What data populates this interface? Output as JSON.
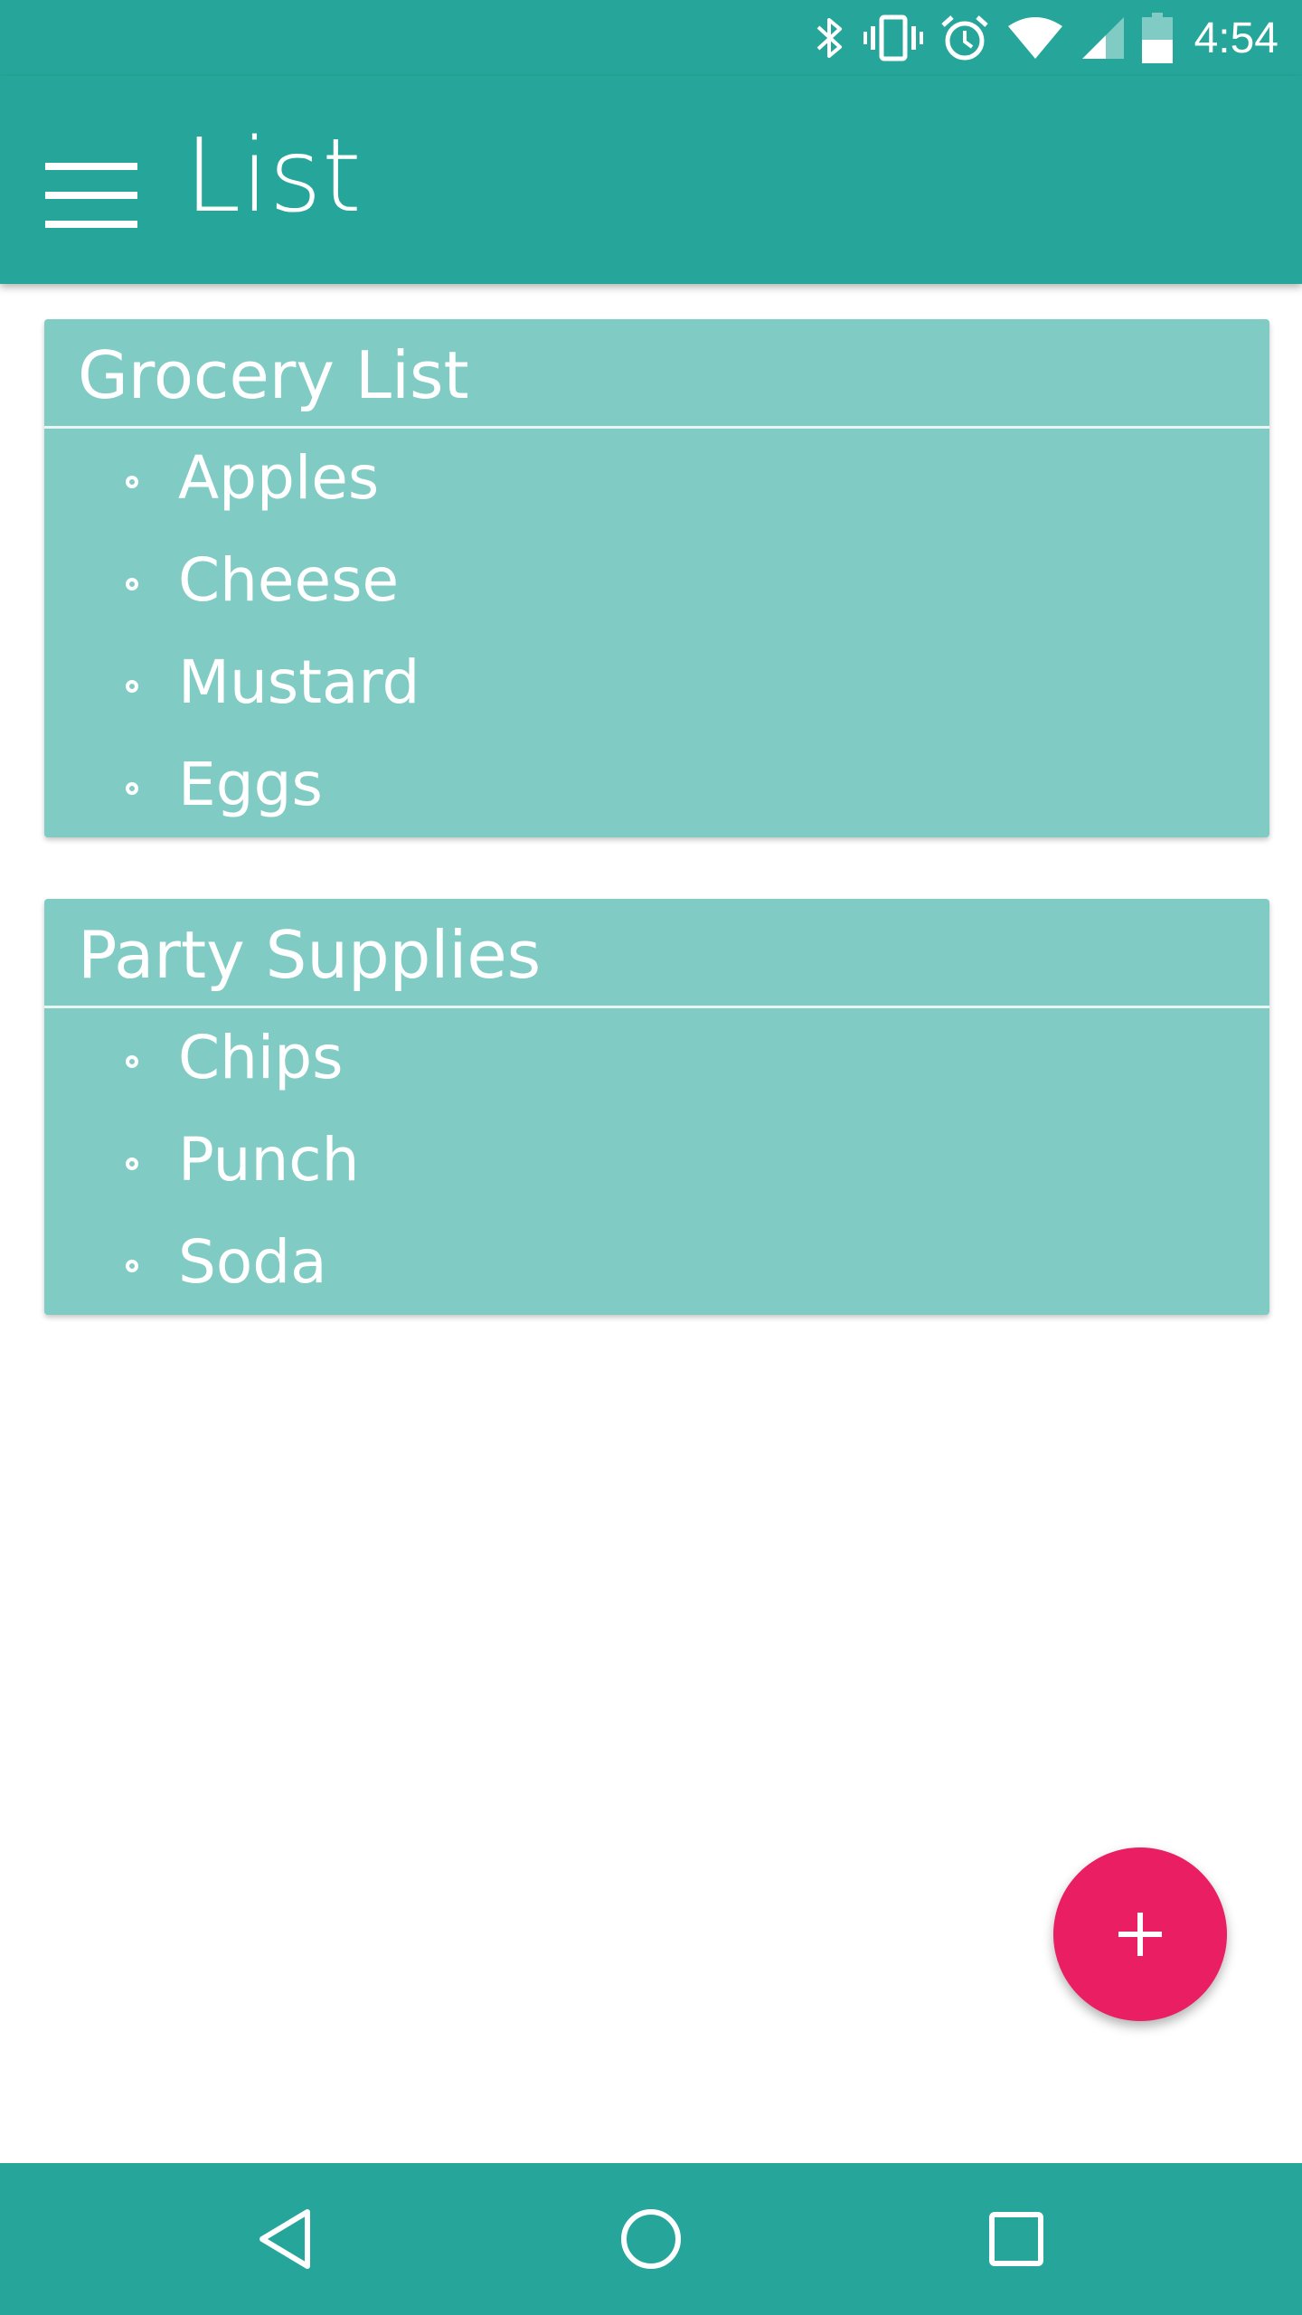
{
  "status_bar": {
    "time": "4:54",
    "icons": [
      "bluetooth-icon",
      "vibrate-icon",
      "alarm-icon",
      "wifi-icon",
      "cell-signal-icon",
      "battery-icon"
    ]
  },
  "app_bar": {
    "title": "List",
    "menu_icon": "hamburger-menu-icon"
  },
  "lists": [
    {
      "title": "Grocery List",
      "items": [
        "Apples",
        "Cheese",
        "Mustard",
        "Eggs"
      ]
    },
    {
      "title": "Party Supplies",
      "items": [
        "Chips",
        "Punch",
        "Soda"
      ]
    }
  ],
  "fab": {
    "icon": "plus-icon"
  },
  "nav_bar": {
    "icons": [
      "back-icon",
      "home-icon",
      "recents-icon"
    ]
  },
  "colors": {
    "primary": "#26a69a",
    "card": "#80cbc4",
    "accent": "#e91e63",
    "text_on_primary": "#ffffff"
  }
}
